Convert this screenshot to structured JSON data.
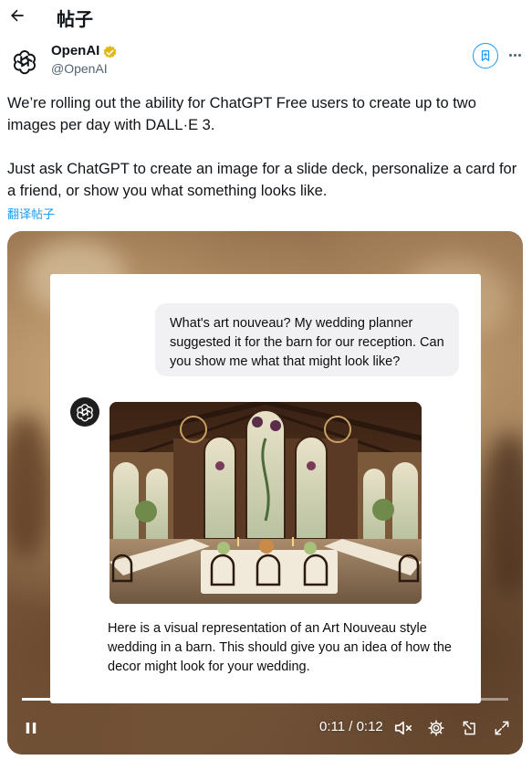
{
  "header": {
    "title": "帖子",
    "back_icon": "arrow-left-icon"
  },
  "author": {
    "name": "OpenAI",
    "handle": "@OpenAI",
    "verified_color": "#e2b719",
    "avatar_icon": "openai-logo-icon"
  },
  "tweet": {
    "paragraph1": "We’re rolling out the ability for ChatGPT Free users to create up to two images per day with DALL·E 3.",
    "paragraph2": "Just ask ChatGPT to create an image for a slide deck, personalize a card for a friend, or show you what something looks like.",
    "translate_label": "翻译帖子"
  },
  "media": {
    "user_message": "What's art nouveau? My wedding planner suggested it for the barn for our reception. Can you show me what that might look like?",
    "assistant_message": "Here is a visual representation of an Art Nouveau style wedding in a barn. This should give you an idea of how the decor might look for your wedding.",
    "video": {
      "time": "0:11 / 0:12",
      "progress": 0.92
    }
  },
  "colors": {
    "accent": "#1d9bf0",
    "text": "#0f1419",
    "muted": "#536471"
  }
}
